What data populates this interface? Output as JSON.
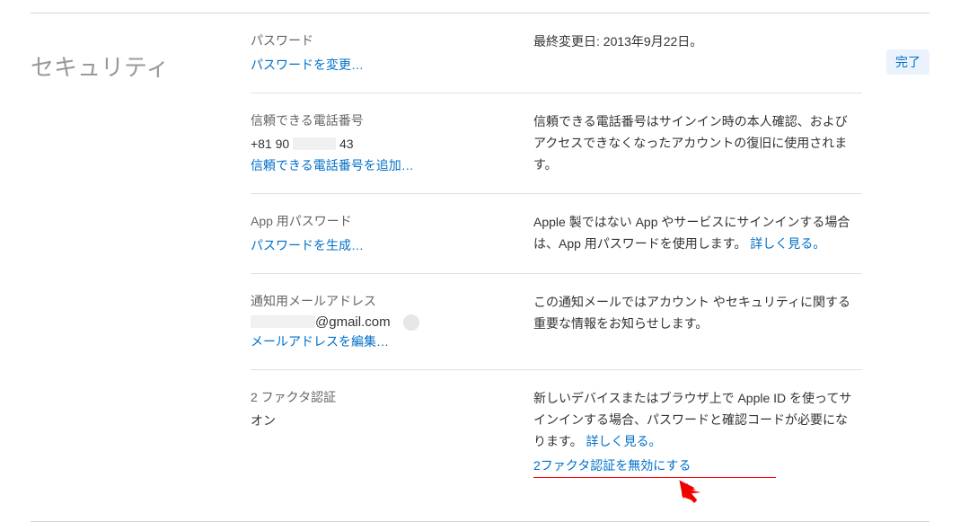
{
  "section_title": "セキュリティ",
  "done_label": "完了",
  "rows": {
    "password": {
      "label": "パスワード",
      "link": "パスワードを変更…",
      "desc": "最終変更日: 2013年9月22日。"
    },
    "phone": {
      "label": "信頼できる電話番号",
      "prefix": "+81 90",
      "suffix": "43",
      "link": "信頼できる電話番号を追加…",
      "desc": "信頼できる電話番号はサインイン時の本人確認、およびアクセスできなくなったアカウントの復旧に使用されます。"
    },
    "app_pw": {
      "label": "App 用パスワード",
      "link": "パスワードを生成…",
      "desc_pre": "Apple 製ではない App やサービスにサインインする場合は、App 用パスワードを使用します。",
      "learn": "詳しく見る。"
    },
    "email": {
      "label": "通知用メールアドレス",
      "domain": "@gmail.com",
      "link": "メールアドレスを編集…",
      "desc": "この通知メールではアカウント やセキュリティに関する重要な情報をお知らせします。"
    },
    "tfa": {
      "label": "2 ファクタ認証",
      "value": "オン",
      "desc_pre": "新しいデバイスまたはブラウザ上で Apple ID を使ってサインインする場合、パスワードと確認コードが必要になります。",
      "learn": "詳しく見る。",
      "disable": "2ファクタ認証を無効にする"
    }
  }
}
